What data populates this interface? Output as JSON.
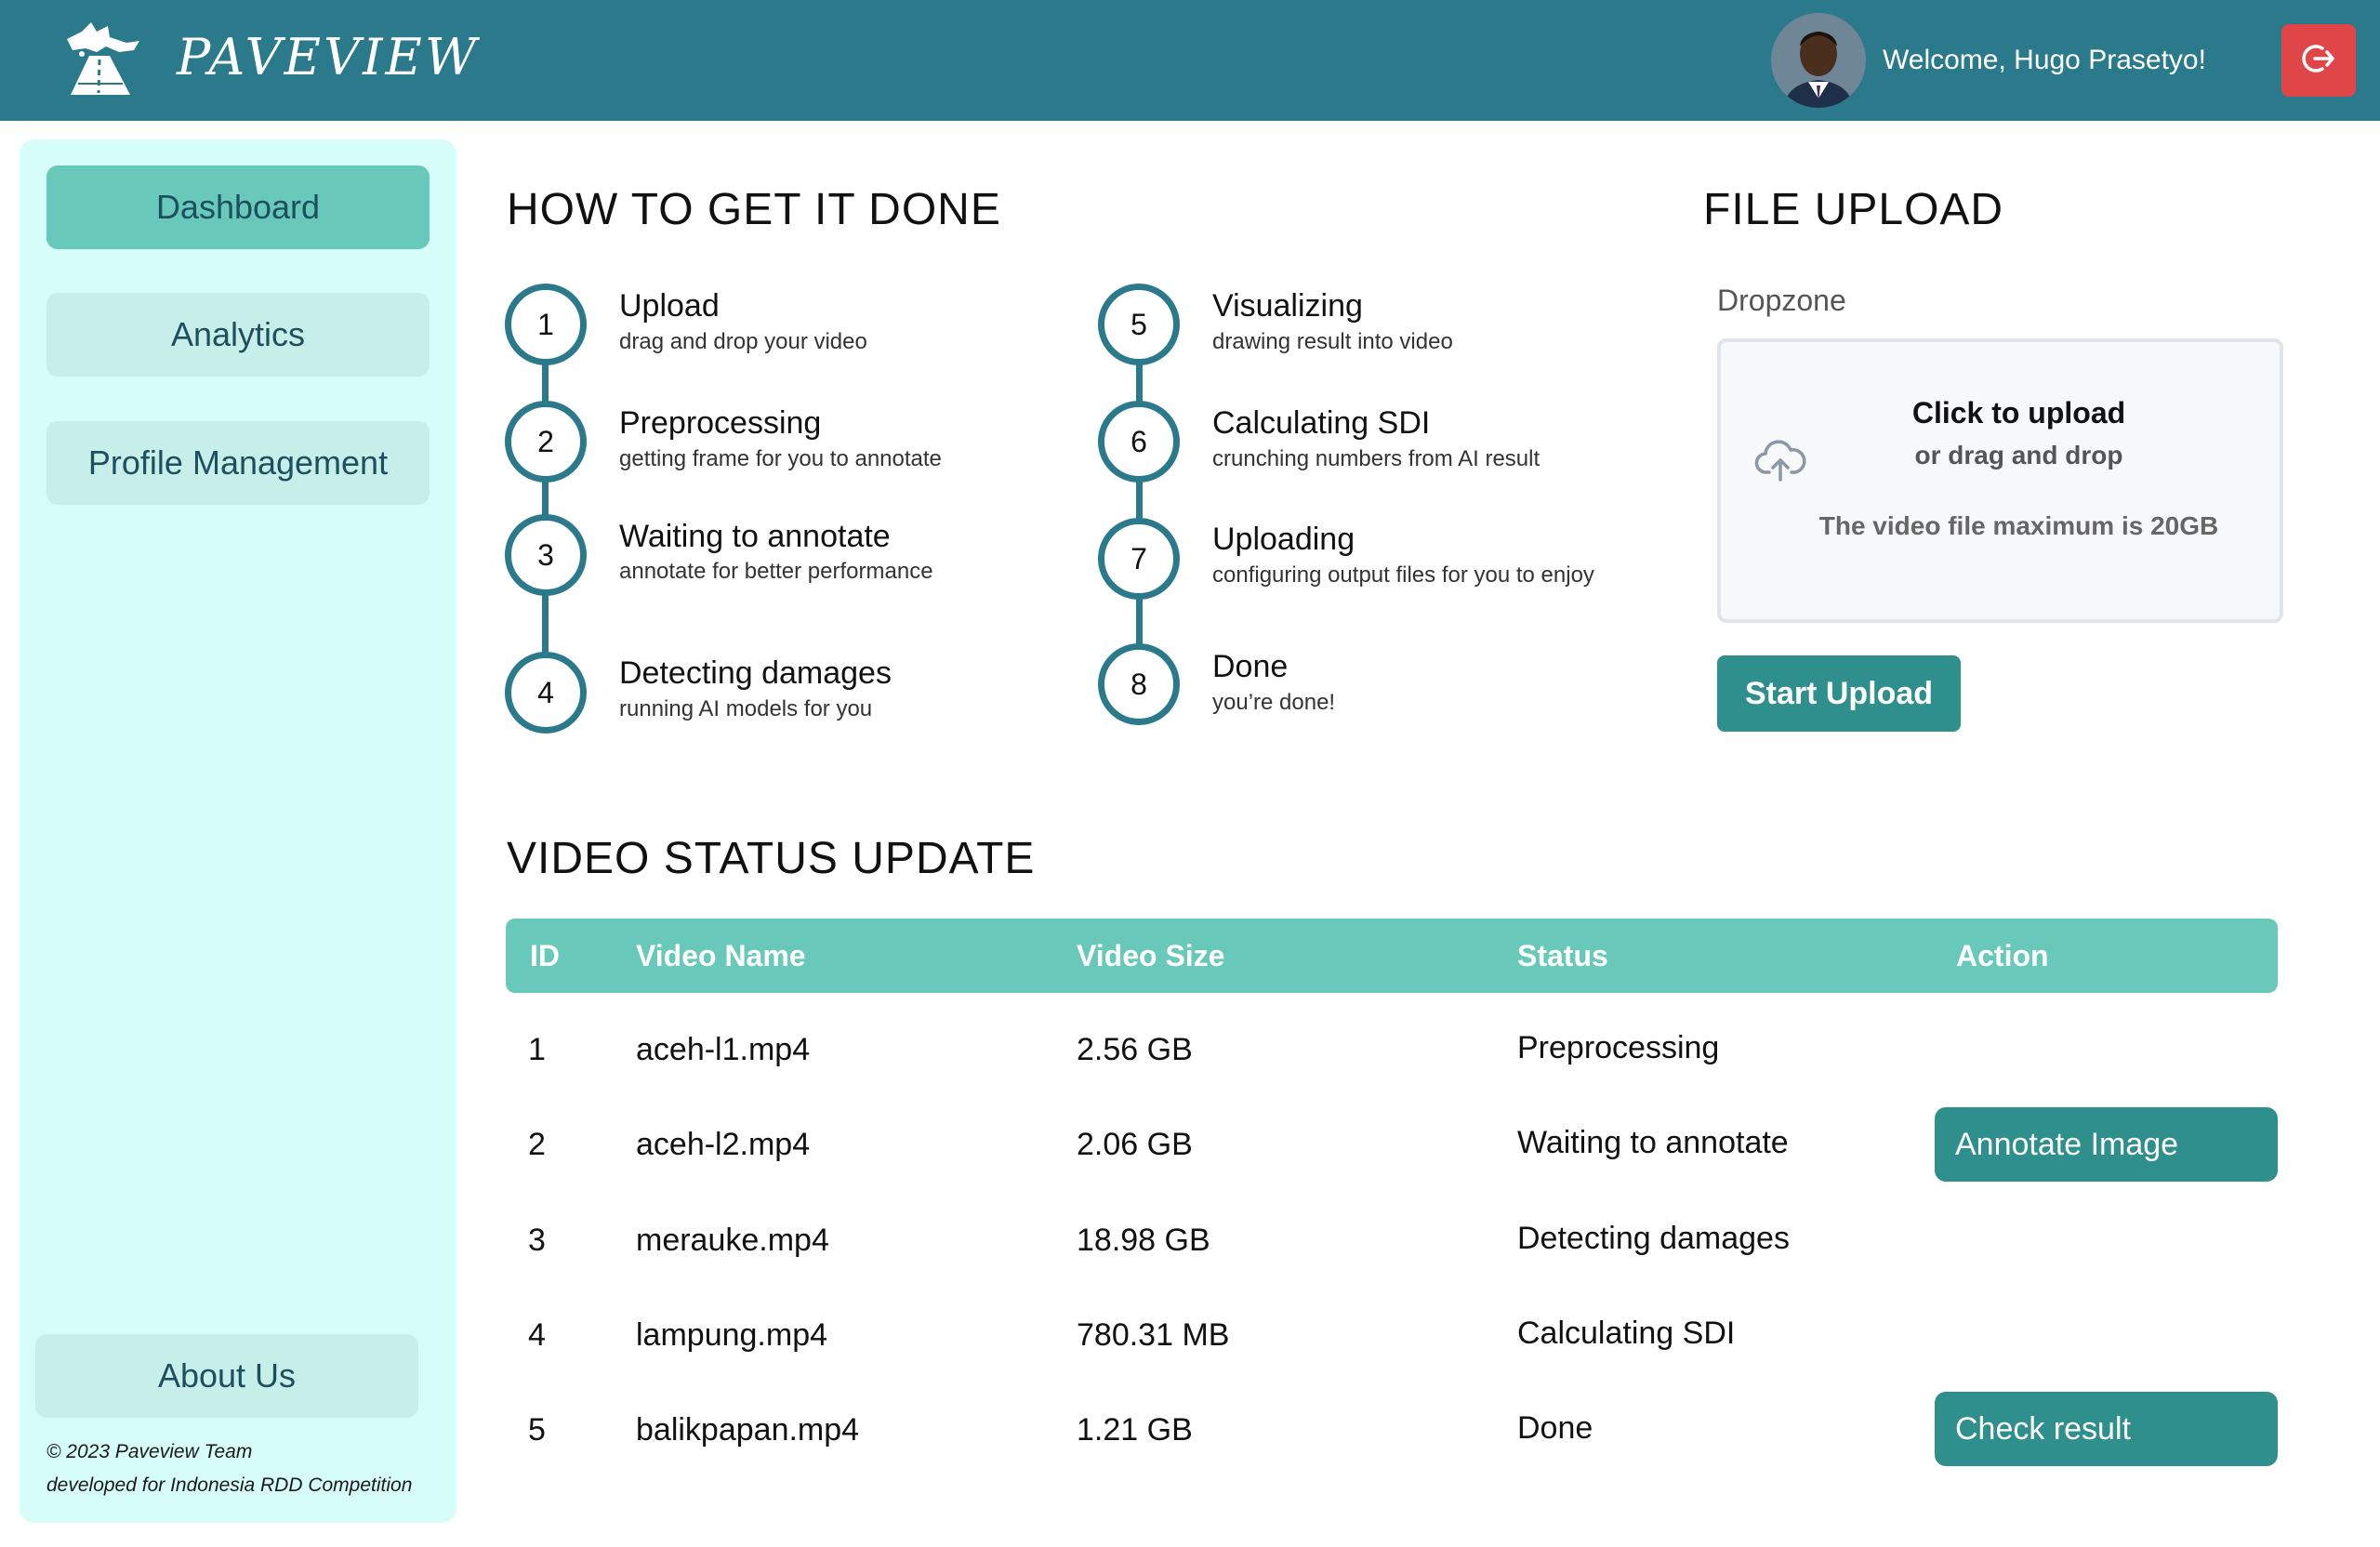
{
  "header": {
    "brand": "PAVEVIEW",
    "welcome": "Welcome, Hugo Prasetyo!",
    "logo_icon": "paveview-logo-icon",
    "logout_icon": "logout-icon",
    "colors": {
      "header_bg": "#2b7a8c",
      "logout_bg": "#e04547"
    }
  },
  "sidebar": {
    "items": [
      {
        "label": "Dashboard",
        "active": true
      },
      {
        "label": "Analytics",
        "active": false
      },
      {
        "label": "Profile Management",
        "active": false
      }
    ],
    "about": "About Us",
    "copyright": "© 2023 Paveview Team",
    "credit": "developed for Indonesia RDD Competition"
  },
  "how_to": {
    "title": "HOW TO GET IT DONE",
    "steps": [
      {
        "number": "1",
        "title": "Upload",
        "desc": "drag and drop your video"
      },
      {
        "number": "2",
        "title": "Preprocessing",
        "desc": "getting frame for you to annotate"
      },
      {
        "number": "3",
        "title": "Waiting to annotate",
        "desc": "annotate for better performance"
      },
      {
        "number": "4",
        "title": "Detecting damages",
        "desc": "running AI models for you"
      },
      {
        "number": "5",
        "title": "Visualizing",
        "desc": "drawing result into video"
      },
      {
        "number": "6",
        "title": "Calculating SDI",
        "desc": "crunching numbers from AI result"
      },
      {
        "number": "7",
        "title": "Uploading",
        "desc": "configuring output files for you to enjoy"
      },
      {
        "number": "8",
        "title": "Done",
        "desc": "you’re done!"
      }
    ]
  },
  "file_upload": {
    "title": "FILE UPLOAD",
    "dropzone_label": "Dropzone",
    "click_text": "Click to upload",
    "drag_text": "or drag and drop",
    "max_text": "The video file maximum is 20GB",
    "upload_icon": "cloud-upload-icon",
    "start_button": "Start Upload"
  },
  "video_status": {
    "title": "VIDEO STATUS UPDATE",
    "columns": [
      "ID",
      "Video Name",
      "Video Size",
      "Status",
      "Action"
    ],
    "rows": [
      {
        "id": "1",
        "name": "aceh-l1.mp4",
        "size": "2.56 GB",
        "status": "Preprocessing",
        "action": ""
      },
      {
        "id": "2",
        "name": "aceh-l2.mp4",
        "size": "2.06 GB",
        "status": "Waiting to annotate",
        "action": "Annotate Image"
      },
      {
        "id": "3",
        "name": "merauke.mp4",
        "size": "18.98 GB",
        "status": "Detecting damages",
        "action": ""
      },
      {
        "id": "4",
        "name": "lampung.mp4",
        "size": "780.31 MB",
        "status": "Calculating SDI",
        "action": ""
      },
      {
        "id": "5",
        "name": "balikpapan.mp4",
        "size": "1.21 GB",
        "status": "Done",
        "action": "Check result"
      }
    ]
  }
}
